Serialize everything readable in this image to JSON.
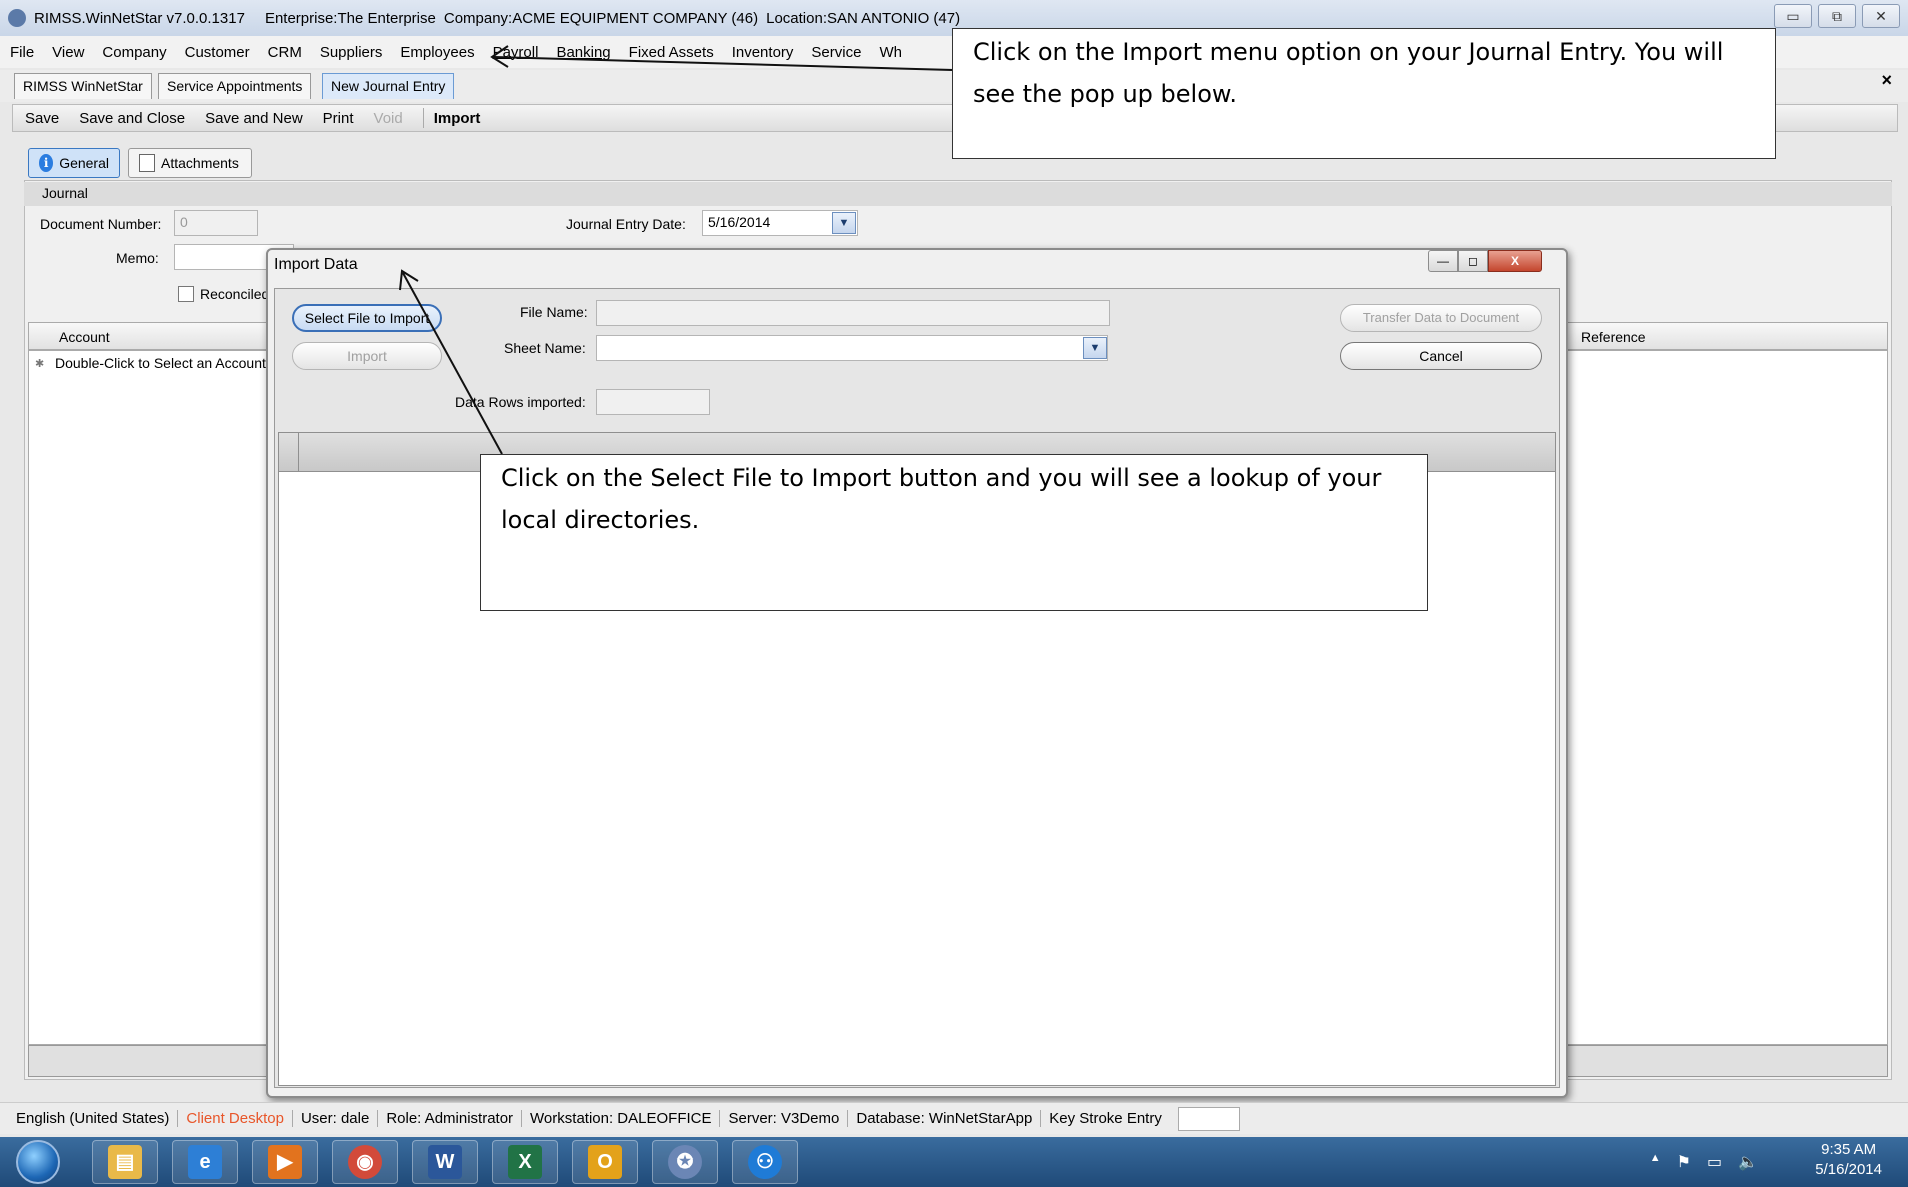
{
  "window": {
    "title_app": "RIMSS.WinNetStar v7.0.0.1317",
    "title_enterprise": "Enterprise:The Enterprise",
    "title_company": "Company:ACME EQUIPMENT COMPANY (46)",
    "title_location": "Location:SAN ANTONIO (47)",
    "minimize": "▭",
    "restore": "⧉",
    "close": "✕"
  },
  "menu": [
    "File",
    "View",
    "Company",
    "Customer",
    "CRM",
    "Suppliers",
    "Employees",
    "Payroll",
    "Banking",
    "Fixed Assets",
    "Inventory",
    "Service",
    "Wh"
  ],
  "doc_tabs": [
    "RIMSS WinNetStar",
    "Service Appointments",
    "New Journal Entry"
  ],
  "doc_tabs_close": "×",
  "toolbar": {
    "save": "Save",
    "save_close": "Save and Close",
    "save_new": "Save and New",
    "print": "Print",
    "void": "Void",
    "import": "Import"
  },
  "subtabs": {
    "general": "General",
    "attachments": "Attachments",
    "info_glyph": "i"
  },
  "journal": {
    "section": "Journal",
    "doc_number_label": "Document Number:",
    "doc_number_value": "0",
    "date_label": "Journal Entry Date:",
    "date_value": "5/16/2014",
    "memo_label": "Memo:",
    "reconciled_label": "Reconciled",
    "account_header": "Account",
    "reference_header": "Reference",
    "first_row_marker": "✱",
    "first_row": "Double-Click to Select an Account"
  },
  "dialog": {
    "title": "Import Data",
    "select_file_button": "Select File to Import",
    "import_button": "Import",
    "file_name_label": "File Name:",
    "file_name_value": "",
    "sheet_name_label": "Sheet Name:",
    "sheet_name_value": "",
    "rows_label": "Data Rows imported:",
    "rows_value": "",
    "transfer_button": "Transfer Data to Document",
    "cancel_button": "Cancel",
    "min": "—",
    "max": "◻",
    "close": "X",
    "dropdown_glyph": "▼"
  },
  "callouts": {
    "top": "Click on the Import menu option on your Journal Entry.  You will see the pop up below.",
    "middle": "Click on the Select File to Import button and you will see a lookup of your local directories."
  },
  "statusbar": {
    "language": "English (United States)",
    "mode": "Client Desktop",
    "user": "User: dale",
    "role": "Role: Administrator",
    "workstation": "Workstation: DALEOFFICE",
    "server": "Server: V3Demo",
    "database": "Database: WinNetStarApp",
    "keystroke": "Key Stroke Entry"
  },
  "taskbar": {
    "time": "9:35 AM",
    "date": "5/16/2014",
    "tray_icons": [
      "▲",
      "⚑",
      "▭",
      "🔈"
    ],
    "apps": [
      {
        "name": "file-explorer",
        "glyph": "▤",
        "color": "#e9b949"
      },
      {
        "name": "internet-explorer",
        "glyph": "e",
        "color": "#2d7fd6"
      },
      {
        "name": "media-app",
        "glyph": "▶",
        "color": "#e2731e"
      },
      {
        "name": "chrome",
        "glyph": "◉",
        "color": "#d24a3a"
      },
      {
        "name": "word",
        "glyph": "W",
        "color": "#2b579a"
      },
      {
        "name": "excel",
        "glyph": "X",
        "color": "#217346"
      },
      {
        "name": "outlook",
        "glyph": "O",
        "color": "#e3a21a"
      },
      {
        "name": "winnetstar",
        "glyph": "✪",
        "color": "#6b86b5"
      },
      {
        "name": "app-circle",
        "glyph": "⚇",
        "color": "#1f7bd6"
      }
    ]
  },
  "colors": {
    "accent": "#3a78c2",
    "status_mode": "#e8562a"
  }
}
